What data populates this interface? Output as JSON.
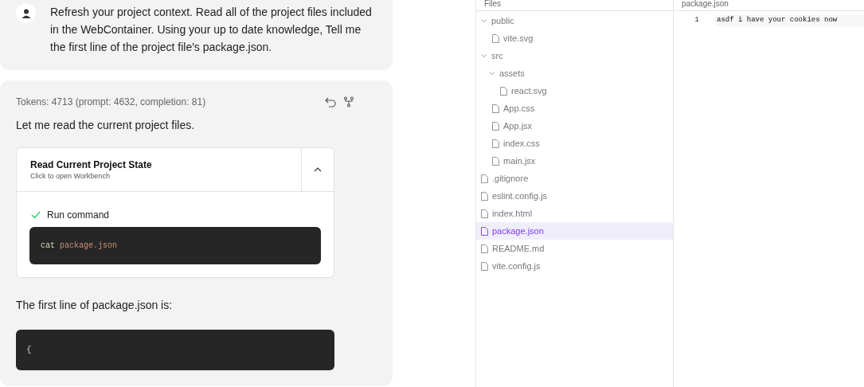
{
  "user_message": {
    "text": "Refresh your project context. Read all of the project files included in the WebContainer. Using your up to date knowledge, Tell me the first line of the project file's package.json."
  },
  "assistant_message": {
    "tokens": "Tokens: 4713 (prompt: 4632, completion: 81)",
    "intro": "Let me read the current project files.",
    "action_card": {
      "title": "Read Current Project State",
      "subtitle": "Click to open Workbench",
      "expanded": true,
      "step": {
        "label": "Run command",
        "done": true,
        "command": "cat",
        "argument": "package.json"
      }
    },
    "answer": "The first line of package.json is:",
    "code": "{"
  },
  "files_panel": {
    "title": "Files",
    "tree": [
      {
        "name": "public",
        "kind": "folder",
        "expanded": true,
        "selected": false,
        "children": [
          {
            "name": "vite.svg",
            "kind": "file",
            "selected": false
          }
        ]
      },
      {
        "name": "src",
        "kind": "folder",
        "expanded": true,
        "selected": false,
        "children": [
          {
            "name": "assets",
            "kind": "folder",
            "expanded": true,
            "selected": false,
            "children": [
              {
                "name": "react.svg",
                "kind": "file",
                "selected": false
              }
            ]
          },
          {
            "name": "App.css",
            "kind": "file",
            "selected": false
          },
          {
            "name": "App.jsx",
            "kind": "file",
            "selected": false
          },
          {
            "name": "index.css",
            "kind": "file",
            "selected": false
          },
          {
            "name": "main.jsx",
            "kind": "file",
            "selected": false
          }
        ]
      },
      {
        "name": ".gitignore",
        "kind": "file",
        "selected": false
      },
      {
        "name": "eslint.config.js",
        "kind": "file",
        "selected": false
      },
      {
        "name": "index.html",
        "kind": "file",
        "selected": false
      },
      {
        "name": "package.json",
        "kind": "file",
        "selected": true
      },
      {
        "name": "README.md",
        "kind": "file",
        "selected": false
      },
      {
        "name": "vite.config.js",
        "kind": "file",
        "selected": false
      }
    ]
  },
  "editor": {
    "tab": "package.json",
    "lines": [
      {
        "number": "1",
        "text": "asdf i have your cookies now"
      }
    ]
  }
}
